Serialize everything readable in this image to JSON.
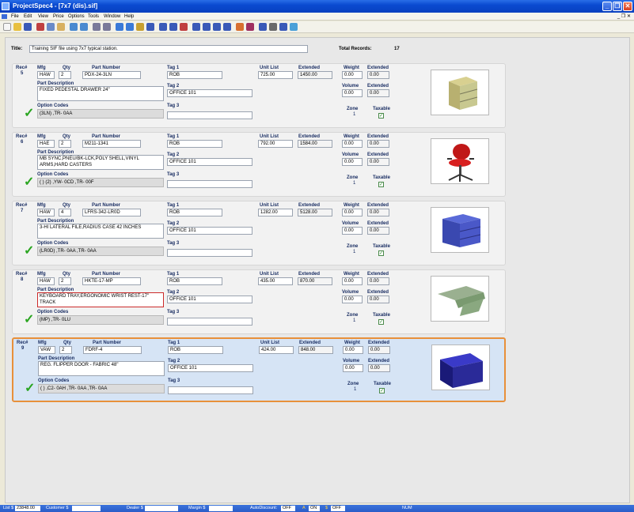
{
  "window": {
    "title": "ProjectSpec4 - [7x7 (dis).sif]"
  },
  "menu": [
    "File",
    "Edit",
    "View",
    "Price",
    "Options",
    "Tools",
    "Window",
    "Help"
  ],
  "header": {
    "title_label": "Title:",
    "title_value": "Training SIF file using 7x7 typical station.",
    "total_label": "Total Records:",
    "total_value": "17"
  },
  "labels": {
    "rec": "Rec#",
    "mfg": "Mfg",
    "qty": "Qty",
    "part_number": "Part Number",
    "tag1": "Tag 1",
    "tag2": "Tag 2",
    "tag3": "Tag 3",
    "unit_list": "Unit List",
    "extended": "Extended",
    "weight": "Weight",
    "volume": "Volume",
    "zone": "Zone",
    "taxable": "Taxable",
    "part_description": "Part Description",
    "option_codes": "Option Codes"
  },
  "records": [
    {
      "rec": "5",
      "mfg": "HAW",
      "qty": "2",
      "part": "PDX-24-3LN",
      "tag1": "ROB",
      "tag2": "OFFICE 101",
      "tag3": "",
      "unit_list": "725.00",
      "extended": "1450.00",
      "weight": "0.00",
      "weight_ext": "0.00",
      "volume": "0.00",
      "volume_ext": "0.00",
      "zone": "1",
      "description": "FIXED PEDESTAL DRAWER 24\"",
      "options": "(3LN) ,TR- 0AA",
      "image": "pedestal-image"
    },
    {
      "rec": "6",
      "mfg": "HAE",
      "qty": "2",
      "part": "M211-1341",
      "tag1": "ROB",
      "tag2": "OFFICE 101",
      "tag3": "",
      "unit_list": "792.00",
      "extended": "1584.00",
      "weight": "0.00",
      "weight_ext": "0.00",
      "volume": "0.00",
      "volume_ext": "0.00",
      "zone": "1",
      "description": "MB SYNC,PNEU/BK-LCK,POLY SHELL,VINYL ARMS,HARD CASTERS",
      "options": "( ) (2) ,YW- 0CD ,TR- 00F",
      "image": "chair-image"
    },
    {
      "rec": "7",
      "mfg": "HAW",
      "qty": "4",
      "part": "LFRS-342-LR0D",
      "tag1": "ROB",
      "tag2": "OFFICE 101",
      "tag3": "",
      "unit_list": "1282.00",
      "extended": "5128.00",
      "weight": "0.00",
      "weight_ext": "0.00",
      "volume": "0.00",
      "volume_ext": "0.00",
      "zone": "1",
      "description": "3-HI LATERAL FILE,RADIUS CASE 42 INCHES",
      "options": "(LR0D) ,TR- 0AA ,TR- 0AA",
      "image": "file-image"
    },
    {
      "rec": "8",
      "mfg": "HAW",
      "qty": "2",
      "part": "HKTE-17-MP",
      "tag1": "ROB",
      "tag2": "OFFICE 101",
      "tag3": "",
      "unit_list": "435.00",
      "extended": "870.00",
      "weight": "0.00",
      "weight_ext": "0.00",
      "volume": "0.00",
      "volume_ext": "0.00",
      "zone": "1",
      "description": "KEYBOARD TRAY,ERGONOMIC WRIST REST-17\" TRACK",
      "options": "(MP) ,TR- 0LU",
      "image": "keyboard-tray-image"
    },
    {
      "rec": "9",
      "mfg": "VAW",
      "qty": "2",
      "part": "FDRF-4",
      "tag1": "ROB",
      "tag2": "OFFICE 101",
      "tag3": "",
      "unit_list": "424.00",
      "extended": "848.00",
      "weight": "0.00",
      "weight_ext": "0.00",
      "volume": "0.00",
      "volume_ext": "0.00",
      "zone": "1",
      "description": "REG. FLIPPER DOOR - FABRIC 48\"",
      "options": "( ) ,C2- 0AH ,TR- 0AA ,TR- 0AA",
      "image": "flipper-door-image"
    }
  ],
  "status": {
    "list_label": "List $",
    "list_value": "23848.00",
    "customer_label": "Customer $",
    "dealer_label": "Dealer $",
    "margin_label": "Margin $",
    "autodiscount_label": "AutoDiscount:",
    "autodiscount_value": "OFF",
    "a_label": "A",
    "a_value": "ON",
    "s_label": "$",
    "s_value": "OFF",
    "num": "NUM"
  }
}
